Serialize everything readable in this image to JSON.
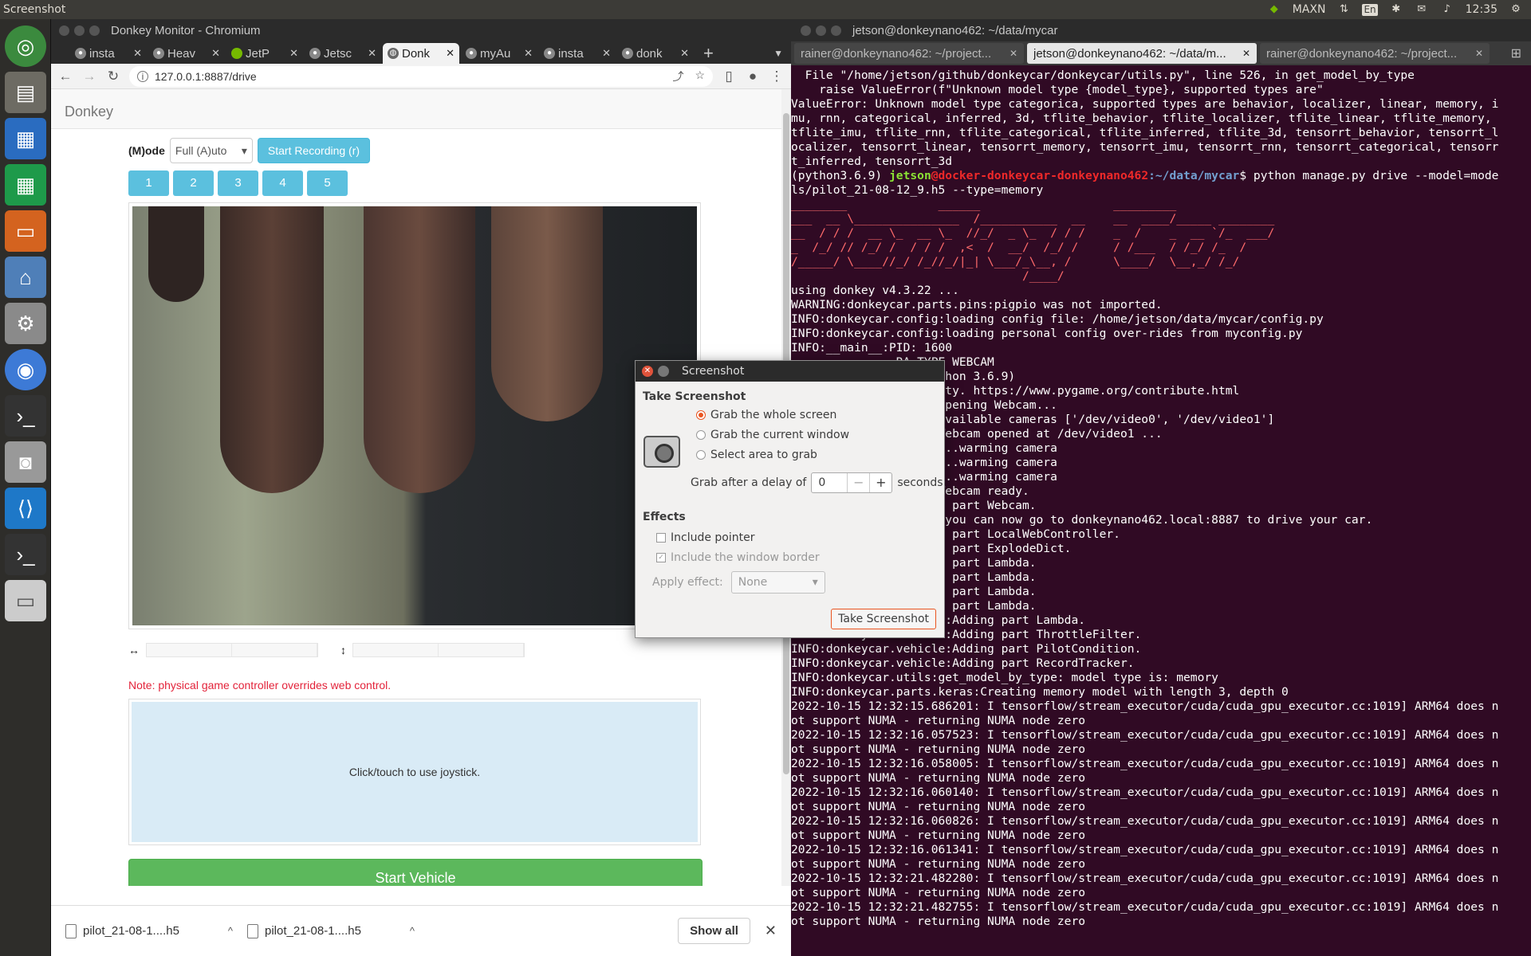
{
  "topbar": {
    "app_name": "Screenshot",
    "tray": [
      "nvidia-icon",
      "MAXN",
      "network-icon",
      "En",
      "bluetooth-icon",
      "mail-icon",
      "volume-icon",
      "12:35",
      "gear-icon"
    ],
    "power_mode": "MAXN",
    "keyboard": "En",
    "clock": "12:35"
  },
  "launcher": [
    "ubuntu-dash-icon",
    "files-icon",
    "writer-icon",
    "calc-icon",
    "impress-icon",
    "software-icon",
    "settings-icon",
    "chromium-icon",
    "terminal-icon",
    "screenshot-icon",
    "vscode-icon",
    "terminal-icon",
    "drive-icon"
  ],
  "browser": {
    "window_title": "Donkey Monitor - Chromium",
    "tabs": [
      {
        "label": "insta",
        "icon": "github"
      },
      {
        "label": "Heav",
        "icon": "github"
      },
      {
        "label": "JetP",
        "icon": "nvidia"
      },
      {
        "label": "Jetsc",
        "icon": "github"
      },
      {
        "label": "Donk",
        "icon": "globe",
        "active": true
      },
      {
        "label": "myAu",
        "icon": "github"
      },
      {
        "label": "insta",
        "icon": "github"
      },
      {
        "label": "donk",
        "icon": "github"
      }
    ],
    "url": "127.0.0.1:8887/drive"
  },
  "donkey": {
    "brand": "Donkey",
    "mode_label": "(M)ode",
    "mode_value": "Full (A)uto",
    "record_button": "Start Recording (r)",
    "presets": [
      "1",
      "2",
      "3",
      "4",
      "5"
    ],
    "note": "Note: physical game controller overrides web control.",
    "joystick_hint": "Click/touch to use joystick.",
    "start_vehicle": "Start Vehicle"
  },
  "downloads": {
    "items": [
      "pilot_21-08-1....h5",
      "pilot_21-08-1....h5"
    ],
    "show_all": "Show all"
  },
  "terminal": {
    "window_title": "jetson@donkeynano462: ~/data/mycar",
    "tabs": [
      {
        "label": "rainer@donkeynano462: ~/project..."
      },
      {
        "label": "jetson@donkeynano462: ~/data/m...",
        "active": true
      },
      {
        "label": "rainer@donkeynano462: ~/project..."
      }
    ],
    "lines": [
      "  File \"/home/jetson/github/donkeycar/donkeycar/utils.py\", line 526, in get_model_by_type",
      "    raise ValueError(f\"Unknown model type {model_type}, supported types are\"",
      "ValueError: Unknown model type categorica, supported types are behavior, localizer, linear, memory, i",
      "mu, rnn, categorical, inferred, 3d, tflite_behavior, tflite_localizer, tflite_linear, tflite_memory,",
      "tflite_imu, tflite_rnn, tflite_categorical, tflite_inferred, tflite_3d, tensorrt_behavior, tensorrt_l",
      "ocalizer, tensorrt_linear, tensorrt_memory, tensorrt_imu, tensorrt_rnn, tensorrt_categorical, tensorr",
      "t_inferred, tensorrt_3d",
      "(python3.6.9) jetson@docker-donkeycar-donkeynano462:~/data/mycar$ python manage.py drive --model=mode",
      "ls/pilot_21-08-12_9.h5 --type=memory",
      "________             ______                   _________              ",
      "___  __ \\_______________  /___________  __    __  ____/_____ ________",
      "__  / / /  __ \\_  __ \\_  //_/  _ \\_  / / /    _  /    _  __ `/_  ___/",
      "_  /_/ // /_/ /  / / /  ,<  /  __/  /_/ /     / /___  / /_/ /_  /    ",
      "/_____/ \\____//_/ /_//_/|_| \\___/_\\__, /      \\____/  \\__,_/ /_/     ",
      "                                 /____/                              ",
      "",
      "using donkey v4.3.22 ...",
      "WARNING:donkeycar.parts.pins:pigpio was not imported.",
      "INFO:donkeycar.config:loading config file: /home/jetson/data/mycar/config.py",
      "INFO:donkeycar.config:loading personal config over-rides from myconfig.py",
      "INFO:__main__:PID: 1600",
      "",
      "               RA_TYPE WEBCAM",
      "               16, Python 3.6.9)",
      "               community. https://www.pygame.org/contribute.html",
      "               amera:Opening Webcam...",
      "               amera:Available cameras ['/dev/video0', '/dev/video1']",
      "               amera:Webcam opened at /dev/video1 ...",
      "               amera:...warming camera",
      "               amera:...warming camera",
      "               amera:...warming camera",
      "               amera:Webcam ready.",
      "               :Adding part Webcam.",
      "               ...... you can now go to donkeynano462.local:8887 to drive your car.",
      "               :Adding part LocalWebController.",
      "               :Adding part ExplodeDict.",
      "               :Adding part Lambda.",
      "               :Adding part Lambda.",
      "               :Adding part Lambda.",
      "               :Adding part Lambda.",
      "INFO:donkeycar.vehicle:Adding part Lambda.",
      "INFO:donkeycar.vehicle:Adding part ThrottleFilter.",
      "INFO:donkeycar.vehicle:Adding part PilotCondition.",
      "INFO:donkeycar.vehicle:Adding part RecordTracker.",
      "INFO:donkeycar.utils:get_model_by_type: model type is: memory",
      "INFO:donkeycar.parts.keras:Creating memory model with length 3, depth 0",
      "2022-10-15 12:32:15.686201: I tensorflow/stream_executor/cuda/cuda_gpu_executor.cc:1019] ARM64 does n",
      "ot support NUMA - returning NUMA node zero",
      "2022-10-15 12:32:16.057523: I tensorflow/stream_executor/cuda/cuda_gpu_executor.cc:1019] ARM64 does n",
      "ot support NUMA - returning NUMA node zero",
      "2022-10-15 12:32:16.058005: I tensorflow/stream_executor/cuda/cuda_gpu_executor.cc:1019] ARM64 does n",
      "ot support NUMA - returning NUMA node zero",
      "2022-10-15 12:32:16.060140: I tensorflow/stream_executor/cuda/cuda_gpu_executor.cc:1019] ARM64 does n",
      "ot support NUMA - returning NUMA node zero",
      "2022-10-15 12:32:16.060826: I tensorflow/stream_executor/cuda/cuda_gpu_executor.cc:1019] ARM64 does n",
      "ot support NUMA - returning NUMA node zero",
      "2022-10-15 12:32:16.061341: I tensorflow/stream_executor/cuda/cuda_gpu_executor.cc:1019] ARM64 does n",
      "ot support NUMA - returning NUMA node zero",
      "2022-10-15 12:32:21.482280: I tensorflow/stream_executor/cuda/cuda_gpu_executor.cc:1019] ARM64 does n",
      "ot support NUMA - returning NUMA node zero",
      "2022-10-15 12:32:21.482755: I tensorflow/stream_executor/cuda/cuda_gpu_executor.cc:1019] ARM64 does n",
      "ot support NUMA - returning NUMA node zero"
    ]
  },
  "dialog": {
    "title": "Screenshot",
    "section_take": "Take Screenshot",
    "options": [
      "Grab the whole screen",
      "Grab the current window",
      "Select area to grab"
    ],
    "selected_option": "Grab the whole screen",
    "delay_label": "Grab after a delay of",
    "delay_value": "0",
    "delay_unit": "seconds",
    "section_effects": "Effects",
    "include_pointer": "Include pointer",
    "include_border": "Include the window border",
    "apply_effect_label": "Apply effect:",
    "apply_effect_value": "None",
    "take_button": "Take Screenshot",
    "accent": "#e95420"
  }
}
